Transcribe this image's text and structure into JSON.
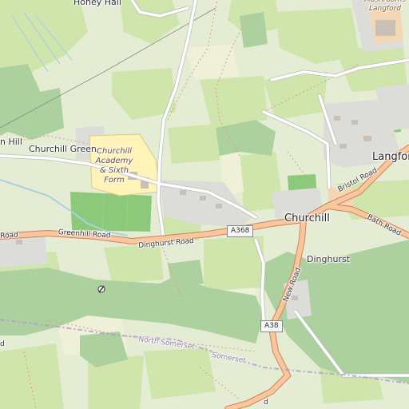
{
  "map": {
    "labels": {
      "honey_hall": "Honey Hall",
      "hill": "n Hill",
      "churchill_green": "Churchill Green",
      "school": "Churchill Academy & Sixth Form",
      "mushrooms": "Mushrooms Langford",
      "langford": "Langford",
      "churchill": "Churchill",
      "dinghurst": "Dinghurst",
      "greenhill_road": "Greenhill Road",
      "dinghurst_road": "Dinghurst Road",
      "bristol_road": "Bristol Road",
      "bath_road": "Bath Road",
      "new_road": "New Road",
      "road_left": "Road",
      "road_bottom": "d",
      "north_somerset": "North Somerset",
      "somerset": "Somerset",
      "edge_d": "d"
    },
    "shields": {
      "a368": "A368",
      "a38": "A38"
    },
    "colors": {
      "meadow": "#c8dfa3",
      "woodland": "#add19e",
      "residential": "#e0dfdf",
      "main_road": "#fcd6a4",
      "main_road_casing": "#e28a6b",
      "school": "#fff7c0",
      "farmyard": "#f5dcba",
      "water": "#aad3df",
      "border": "#b39ad0"
    }
  }
}
